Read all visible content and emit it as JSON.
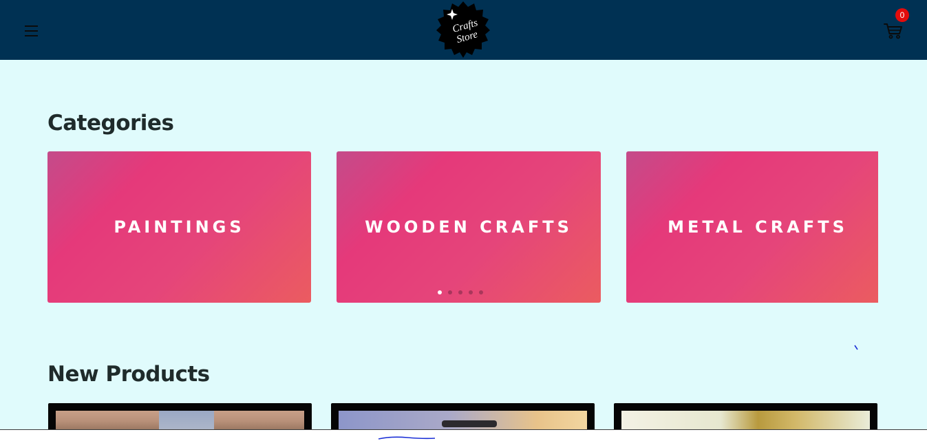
{
  "header": {
    "logo_line1": "Crafts",
    "logo_line2": "Store",
    "cart_count": "0",
    "menu_icon": "hamburger-menu-icon",
    "cart_icon": "shopping-cart-icon"
  },
  "colors": {
    "header_bg": "#003153",
    "page_bg": "#e0fbfc",
    "card_gradient_start": "#c44b8a",
    "card_gradient_end": "#eb5c60",
    "badge": "#e30c0c"
  },
  "categories": {
    "title": "Categories",
    "items": [
      {
        "label": "PAINTINGS"
      },
      {
        "label": "WOODEN CRAFTS"
      },
      {
        "label": "METAL CRAFTS"
      }
    ],
    "carousel": {
      "total_dots": 5,
      "active_index": 0
    }
  },
  "new_products": {
    "title": "New Products",
    "items": [
      {
        "image": "painting-product-image"
      },
      {
        "image": "painting-product-image"
      },
      {
        "image": "metal-craft-product-image"
      }
    ]
  }
}
